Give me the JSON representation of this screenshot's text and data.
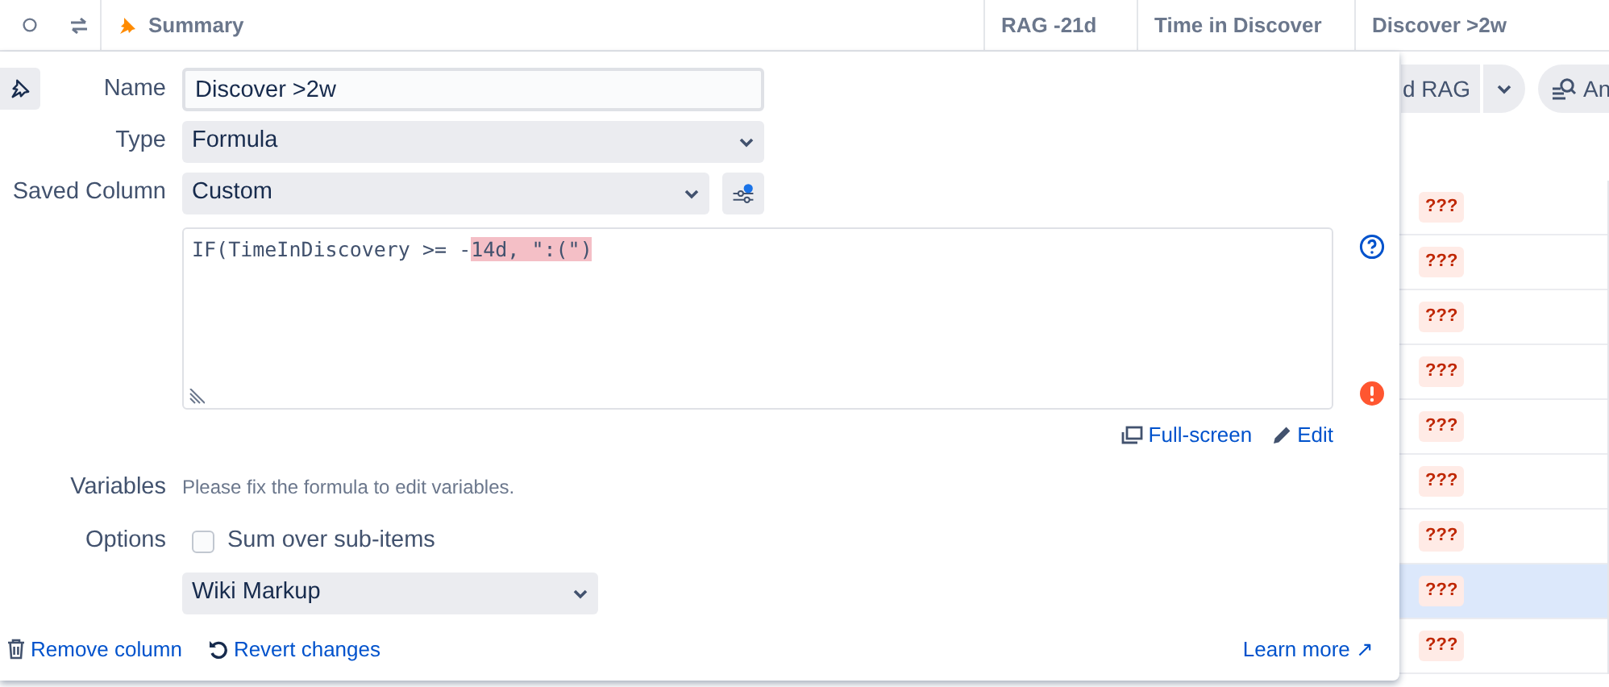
{
  "table": {
    "header_columns": [
      {
        "label": "Summary",
        "kind": "summary"
      },
      {
        "label": "RAG -21d",
        "kind": "plain"
      },
      {
        "label": "Time in Discover",
        "kind": "plain"
      },
      {
        "label": "Discover >2w",
        "kind": "plain"
      }
    ],
    "toolbar": {
      "buttons": [
        {
          "label": "d RAG",
          "kind": "split"
        },
        {
          "label": "An",
          "kind": "search"
        }
      ]
    },
    "rows": [
      {
        "value": "???",
        "selected": false
      },
      {
        "value": "???",
        "selected": false
      },
      {
        "value": "???",
        "selected": false
      },
      {
        "value": "???",
        "selected": false
      },
      {
        "value": "???",
        "selected": false
      },
      {
        "value": "???",
        "selected": false
      },
      {
        "value": "???",
        "selected": false
      },
      {
        "value": "???",
        "selected": true
      },
      {
        "value": "???",
        "selected": false
      }
    ]
  },
  "editor": {
    "name_label": "Name",
    "name_value": "Discover >2w",
    "type_label": "Type",
    "type_value": "Formula",
    "saved_label": "Saved Column",
    "saved_value": "Custom",
    "formula": [
      {
        "text": "IF(TimeInDiscovery >= -",
        "error": false
      },
      {
        "text": "14d, \":(\")",
        "error": true
      }
    ],
    "formula_has_error": true,
    "links": [
      "Full-screen",
      "Edit"
    ],
    "variables_label": "Variables",
    "variables_note": "Please fix the formula to edit variables.",
    "options_label": "Options",
    "sum_over_subitems": {
      "label": "Sum over sub-items",
      "checked": false
    },
    "format_value": "Wiki Markup",
    "footer": {
      "remove": "Remove column",
      "revert": "Revert changes",
      "learn_more": "Learn more ↗"
    }
  }
}
